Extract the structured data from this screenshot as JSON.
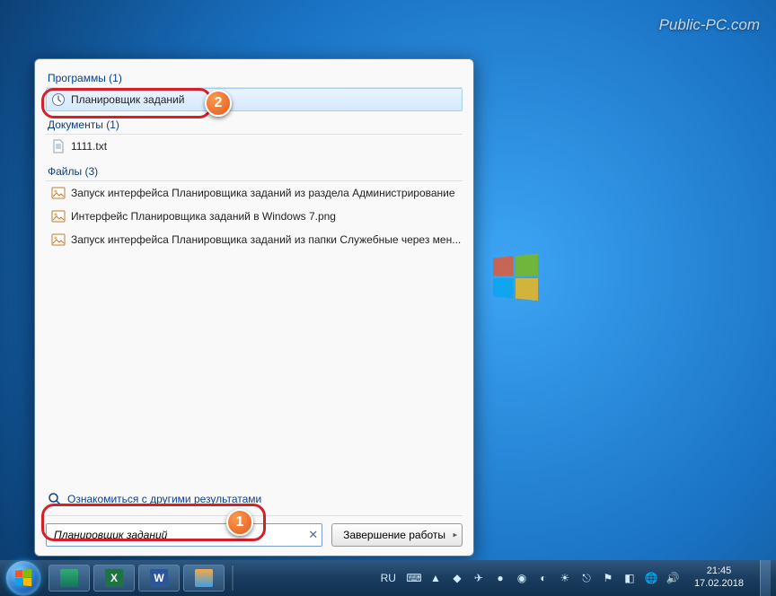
{
  "watermark": "Public-PC.com",
  "startMenu": {
    "programs": {
      "header": "Программы (1)",
      "item": "Планировщик заданий"
    },
    "documents": {
      "header": "Документы (1)",
      "item": "1111.txt"
    },
    "files": {
      "header": "Файлы (3)",
      "items": [
        "Запуск интерфейса Планировщика заданий из раздела Администрирование",
        "Интерфейс Планировщика заданий в Windows 7.png",
        "Запуск интерфейса Планировщика заданий из папки Служебные через мен..."
      ]
    },
    "seeMore": "Ознакомиться с другими результатами",
    "searchValue": "Планировщик заданий",
    "shutdown": "Завершение работы"
  },
  "badges": {
    "b1": "1",
    "b2": "2"
  },
  "taskbar": {
    "lang": "RU",
    "time": "21:45",
    "date": "17.02.2018"
  }
}
